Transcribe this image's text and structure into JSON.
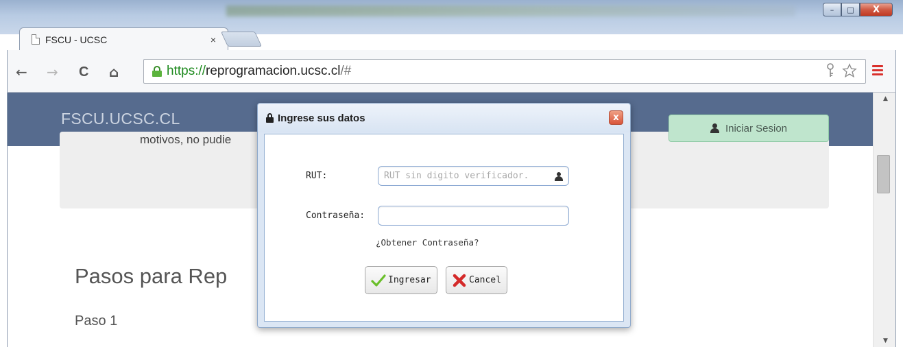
{
  "browser": {
    "tab_title": "FSCU - UCSC",
    "tab_close": "×",
    "url_scheme": "https://",
    "url_host": "reprogramacion.ucsc.cl",
    "url_path": "/#",
    "nav": {
      "back": "←",
      "forward": "→",
      "reload": "C",
      "home": "⌂"
    },
    "window_buttons": {
      "minimize": "–",
      "maximize": "□",
      "close": "X"
    }
  },
  "page": {
    "brand": "FSCU.UCSC.CL",
    "login_button": "Iniciar Sesion",
    "info_text": "motivos, no pudie",
    "steps_title": "Pasos para Rep",
    "step_label": "Paso 1"
  },
  "dialog": {
    "title": "Ingrese sus datos",
    "close": "x",
    "rut_label": "RUT:",
    "rut_placeholder": "RUT sin digito verificador.",
    "rut_value": "",
    "password_label": "Contraseña:",
    "password_value": "",
    "forgot_link": "¿Obtener Contraseña?",
    "submit_button": "Ingresar",
    "cancel_button": "Cancel"
  },
  "icons": {
    "page": "page-icon",
    "lock": "lock-icon",
    "user": "user-icon",
    "key": "key-icon",
    "star": "star-icon",
    "menu": "menu-icon",
    "check": "check-icon",
    "cancel": "x-icon"
  },
  "colors": {
    "header_bg": "#566b8e",
    "login_btn_bg": "#bfe5cd",
    "url_scheme": "#1e8a1e",
    "dialog_bg": "#dbe6f4",
    "menu_icon": "#d9302c"
  }
}
